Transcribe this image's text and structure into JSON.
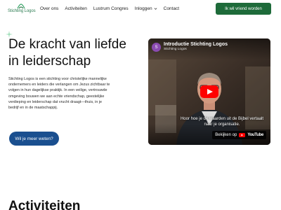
{
  "brand": {
    "name": "Stichting Logos",
    "accent": "#1e6b3a",
    "logo_icon": "logo-mark"
  },
  "nav": {
    "items": [
      {
        "label": "Over ons"
      },
      {
        "label": "Activiteiten"
      },
      {
        "label": "Lustrum Congres"
      },
      {
        "label": "Inloggen",
        "icon": "chevron-down-icon"
      },
      {
        "label": "Contact"
      }
    ],
    "cta_label": "Ik wil vriend worden"
  },
  "hero": {
    "title": "De kracht van liefde in leiderschap",
    "body": "Stichting Logos is een stichting voor christelijke mannelijke ondernemers en leiders die verlangen om Jezus zichtbaar te volgen in hun dagelijkse praktijk. In een veilige, vertrouwde omgeving bouwen we aan echte vriendschap, geestelijke verdieping en leiderschap dat vrucht draagt—thuis, in je bedrijf en in de maatschappij.",
    "button_label": "Wil je meer weten?",
    "button_color": "#1a4f8f"
  },
  "video": {
    "avatar_letter": "S",
    "title": "Introductie Stichting Logos",
    "channel": "Stichting Logos",
    "subtitle": "Hoor hoe je de waarden uit de Bijbel vertaalt naar je organisatie.",
    "watch_label": "Bekijken op",
    "platform": "YouTube",
    "play_color": "#ff0000"
  },
  "section": {
    "title": "Activiteiten"
  }
}
